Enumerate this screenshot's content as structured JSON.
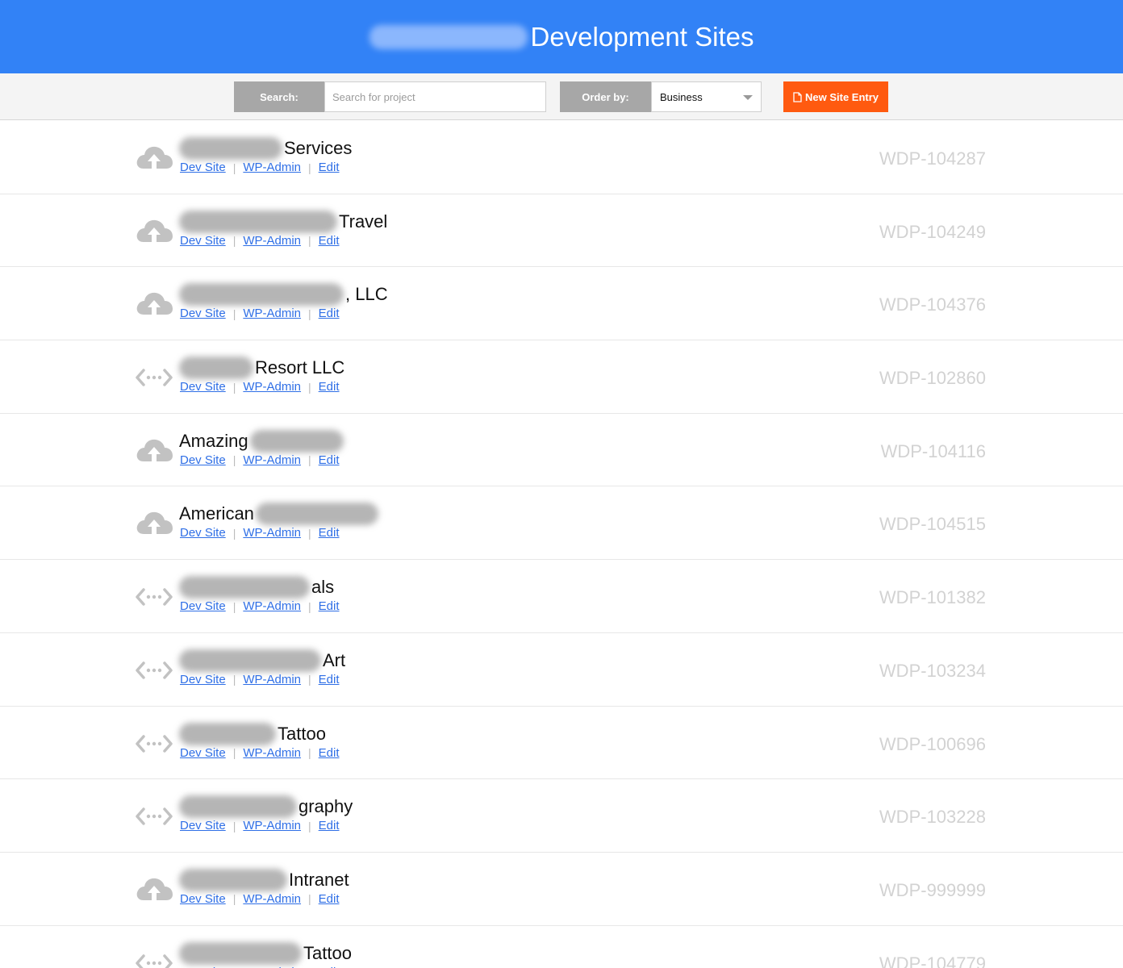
{
  "header": {
    "title": "Development Sites"
  },
  "toolbar": {
    "search_label": "Search:",
    "search_placeholder": "Search for project",
    "order_label": "Order by:",
    "order_value": "Business",
    "new_button": "New Site Entry"
  },
  "colors": {
    "header": "#3282f6",
    "button": "#ff5a10",
    "link": "#2f6fe6"
  },
  "link_labels": {
    "dev": "Dev Site",
    "admin": "WP-Admin",
    "edit": "Edit"
  },
  "rows": [
    {
      "icon": "cloud-upload-icon",
      "title_after": "Services",
      "code": "WDP-104287"
    },
    {
      "icon": "cloud-upload-icon",
      "title_after": "Travel",
      "code": "WDP-104249"
    },
    {
      "icon": "cloud-upload-icon",
      "title_after": ", LLC",
      "code": "WDP-104376"
    },
    {
      "icon": "code-arrows-icon",
      "title_after": "Resort LLC",
      "code": "WDP-102860"
    },
    {
      "icon": "cloud-upload-icon",
      "title_before": "Amazing",
      "code": "WDP-104116"
    },
    {
      "icon": "cloud-upload-icon",
      "title_before": "American",
      "code": "WDP-104515"
    },
    {
      "icon": "code-arrows-icon",
      "title_after": "als",
      "code": "WDP-101382"
    },
    {
      "icon": "code-arrows-icon",
      "title_after": "Art",
      "code": "WDP-103234"
    },
    {
      "icon": "code-arrows-icon",
      "title_after": "Tattoo",
      "code": "WDP-100696"
    },
    {
      "icon": "code-arrows-icon",
      "title_after": "graphy",
      "code": "WDP-103228"
    },
    {
      "icon": "cloud-upload-icon",
      "title_after": "Intranet",
      "code": "WDP-999999"
    },
    {
      "icon": "code-arrows-icon",
      "title_after": "Tattoo",
      "code": "WDP-104779"
    }
  ]
}
